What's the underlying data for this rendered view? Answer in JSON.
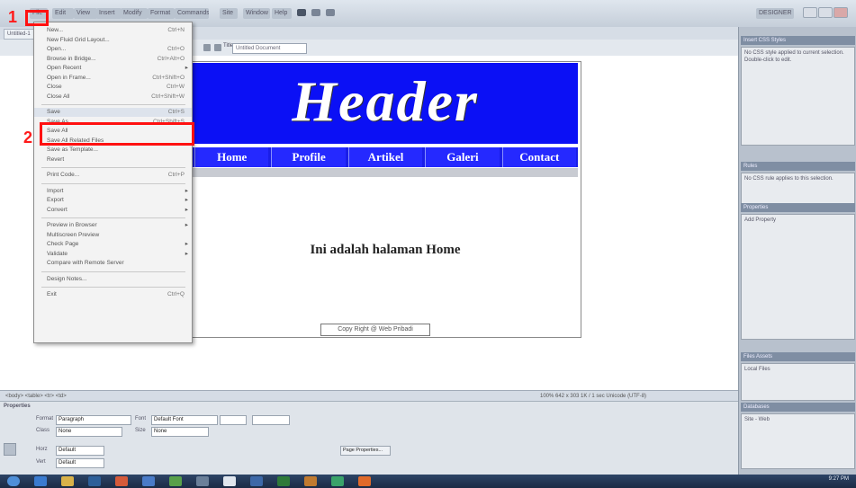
{
  "app": {
    "menu": [
      "File",
      "Edit",
      "View",
      "Insert",
      "Modify",
      "Format",
      "Commands",
      "Site",
      "Window",
      "Help"
    ],
    "titlebar_right": "DESIGNER"
  },
  "document": {
    "title_label": "Title:",
    "title_value": "Untitled Document",
    "tab_label": "Untitled-1"
  },
  "canvas": {
    "header_text": "Header",
    "nav_items": [
      "Home",
      "Profile",
      "Artikel",
      "Galeri",
      "Contact"
    ],
    "body_text": "Ini adalah halaman Home",
    "footer_text": "Copy Right @ Web Pribadi"
  },
  "file_menu": {
    "items": [
      {
        "label": "New...",
        "shortcut": "Ctrl+N"
      },
      {
        "label": "New Fluid Grid Layout...",
        "shortcut": ""
      },
      {
        "label": "Open...",
        "shortcut": "Ctrl+O"
      },
      {
        "label": "Browse in Bridge...",
        "shortcut": "Ctrl+Alt+O"
      },
      {
        "label": "Open Recent",
        "shortcut": "",
        "submenu": true
      },
      {
        "label": "Open in Frame...",
        "shortcut": "Ctrl+Shift+O"
      },
      {
        "label": "Close",
        "shortcut": "Ctrl+W"
      },
      {
        "label": "Close All",
        "shortcut": "Ctrl+Shift+W"
      },
      {
        "sep": true
      },
      {
        "label": "Save",
        "shortcut": "Ctrl+S",
        "highlight": true
      },
      {
        "label": "Save As...",
        "shortcut": "Ctrl+Shift+S"
      },
      {
        "label": "Save All",
        "shortcut": ""
      },
      {
        "label": "Save All Related Files",
        "shortcut": ""
      },
      {
        "label": "Save as Template...",
        "shortcut": ""
      },
      {
        "label": "Revert",
        "shortcut": ""
      },
      {
        "sep": true
      },
      {
        "label": "Print Code...",
        "shortcut": "Ctrl+P"
      },
      {
        "sep": true
      },
      {
        "label": "Import",
        "shortcut": "",
        "submenu": true
      },
      {
        "label": "Export",
        "shortcut": "",
        "submenu": true
      },
      {
        "label": "Convert",
        "shortcut": "",
        "submenu": true
      },
      {
        "sep": true
      },
      {
        "label": "Preview in Browser",
        "shortcut": "",
        "submenu": true
      },
      {
        "label": "Multiscreen Preview",
        "shortcut": ""
      },
      {
        "label": "Check Page",
        "shortcut": "",
        "submenu": true
      },
      {
        "label": "Validate",
        "shortcut": "",
        "submenu": true
      },
      {
        "label": "Compare with Remote Server",
        "shortcut": ""
      },
      {
        "sep": true
      },
      {
        "label": "Design Notes...",
        "shortcut": ""
      },
      {
        "sep": true
      },
      {
        "label": "Exit",
        "shortcut": "Ctrl+Q"
      }
    ]
  },
  "annotations": {
    "marker1": "1",
    "marker2": "2",
    "color": "#ff1111"
  },
  "right_panel": {
    "p1_head": "Insert    CSS Styles",
    "p1_body": "No CSS style applied to current selection. Double-click to edit.",
    "p2_head": "Rules",
    "p2_body": "No CSS rule applies to this selection.",
    "p3_head": "Properties",
    "p3_body": "Add Property",
    "p4_head": "Files    Assets",
    "p4_body": "Local Files",
    "p5_head": "Databases",
    "p5_body": "Site - Web"
  },
  "status": {
    "left": "<body> <table> <tr> <td>",
    "right": "100%   642 x 303   1K / 1 sec   Unicode (UTF-8)"
  },
  "properties": {
    "title": "Properties",
    "format_label": "Format",
    "format_value": "Paragraph",
    "class_label": "Class",
    "class_value": "None",
    "font_label": "Font",
    "font_value": "Default Font",
    "size_label": "Size",
    "size_value": "None",
    "horz_label": "Horz",
    "horz_value": "Default",
    "vert_label": "Vert",
    "vert_value": "Default",
    "page_props": "Page Properties..."
  },
  "taskbar": {
    "clock": "9:27 PM"
  },
  "colors": {
    "header_blue": "#0b10f5",
    "nav_blue": "#2529ff",
    "annotation_red": "#ff1111"
  }
}
